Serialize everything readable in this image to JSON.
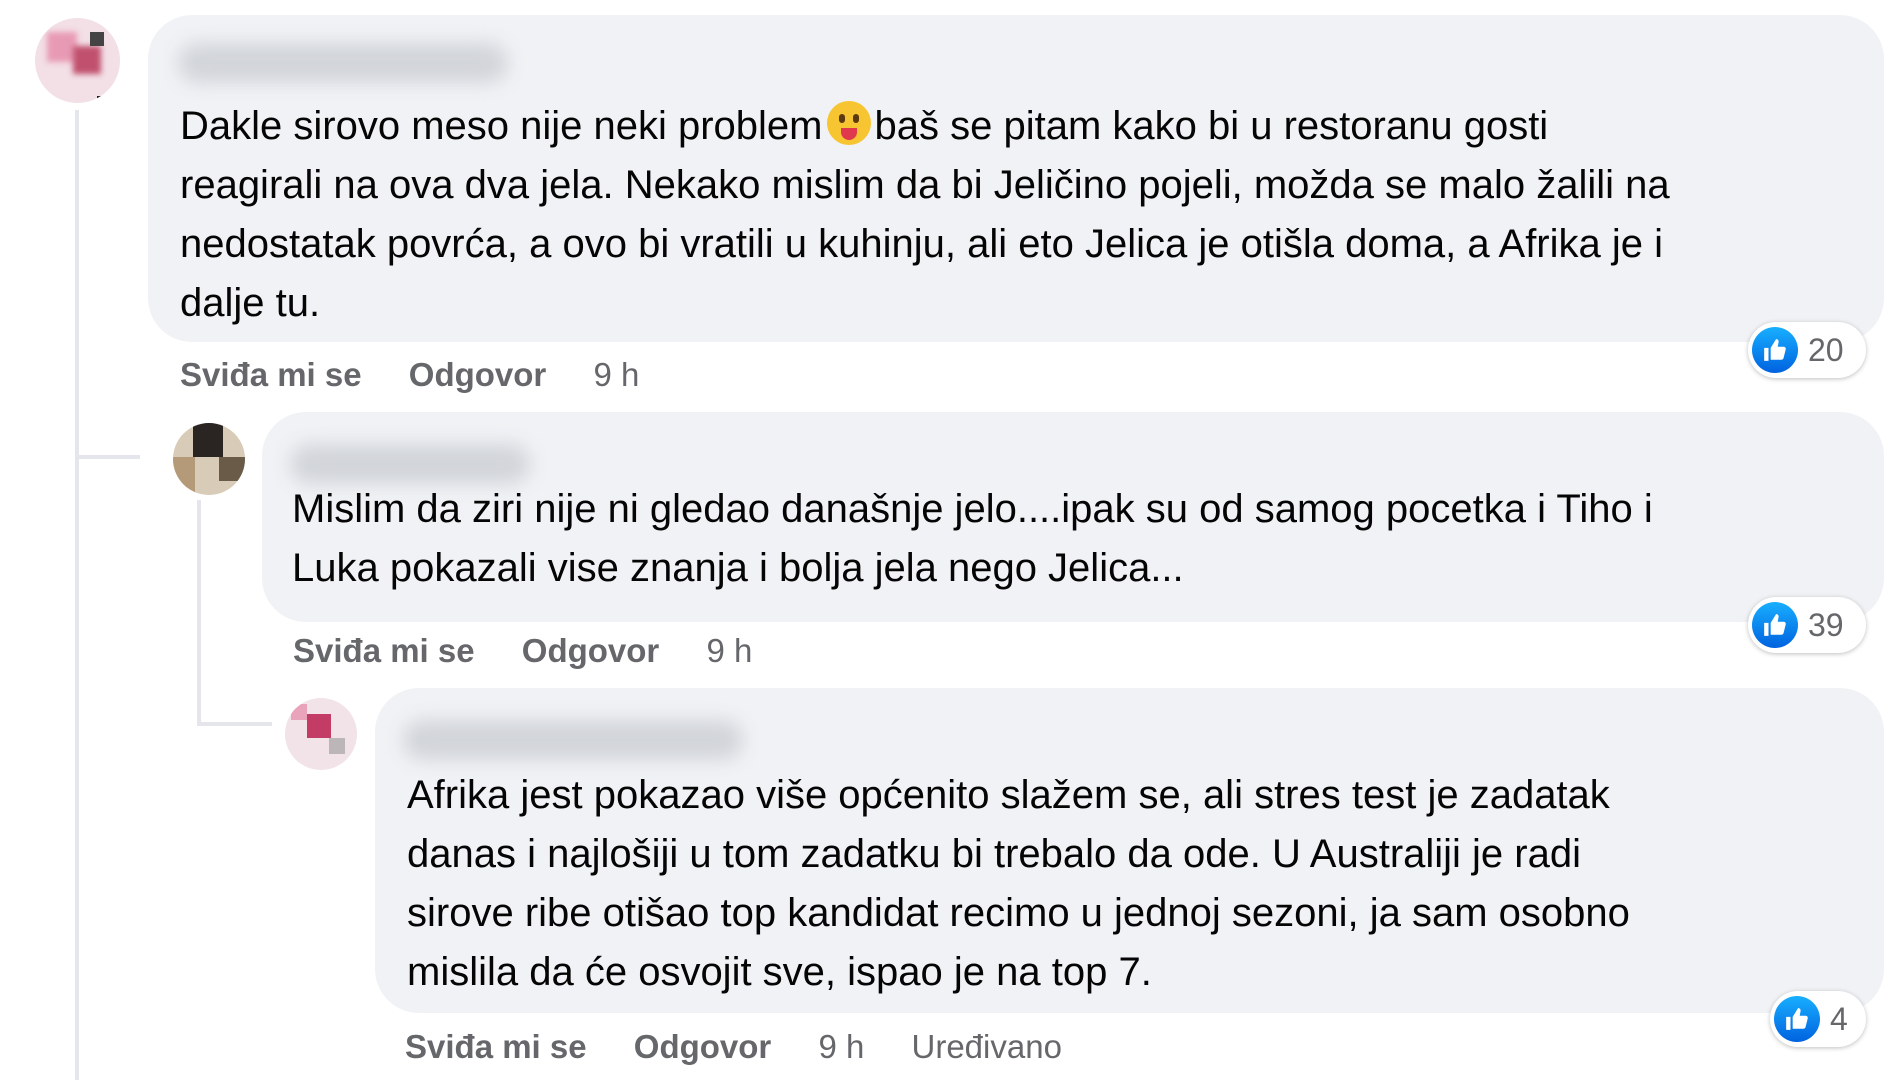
{
  "comments": [
    {
      "text_lines": [
        "Dakle sirovo meso nije neki problem",
        "baš se pitam kako bi u restoranu gosti",
        "reagirali na ova dva jela. Nekako mislim da bi Jeličino pojeli, možda se malo žalili na",
        "nedostatak povrća, a ovo bi vratili u kuhinju, ali eto Jelica je otišla doma, a Afrika je i",
        "dalje tu."
      ],
      "emoji": "tongue-out-emoji",
      "like_label": "Sviđa mi se",
      "reply_label": "Odgovor",
      "time": "9 h",
      "reaction_count": "20"
    },
    {
      "text_lines": [
        "Mislim da ziri nije ni gledao današnje jelo....ipak su od samog pocetka i Tiho i",
        "Luka pokazali vise znanja i bolja jela nego Jelica..."
      ],
      "like_label": "Sviđa mi se",
      "reply_label": "Odgovor",
      "time": "9 h",
      "reaction_count": "39"
    },
    {
      "text_lines": [
        "Afrika jest pokazao više općenito slažem se, ali stres test je zadatak",
        "danas i najlošiji u tom zadatku bi trebalo da ode. U Australiji je radi",
        "sirove ribe otišao top kandidat recimo u jednoj sezoni, ja sam osobno",
        "mislila da će osvojit sve, ispao je na top 7."
      ],
      "like_label": "Sviđa mi se",
      "reply_label": "Odgovor",
      "time": "9 h",
      "edited_label": "Uređivano",
      "reaction_count": "4"
    }
  ],
  "icons": {
    "reaction": "like-icon"
  },
  "colors": {
    "bubble": "#f0f2f5",
    "meta_text": "#65676b",
    "like_blue": "#1877f2"
  }
}
